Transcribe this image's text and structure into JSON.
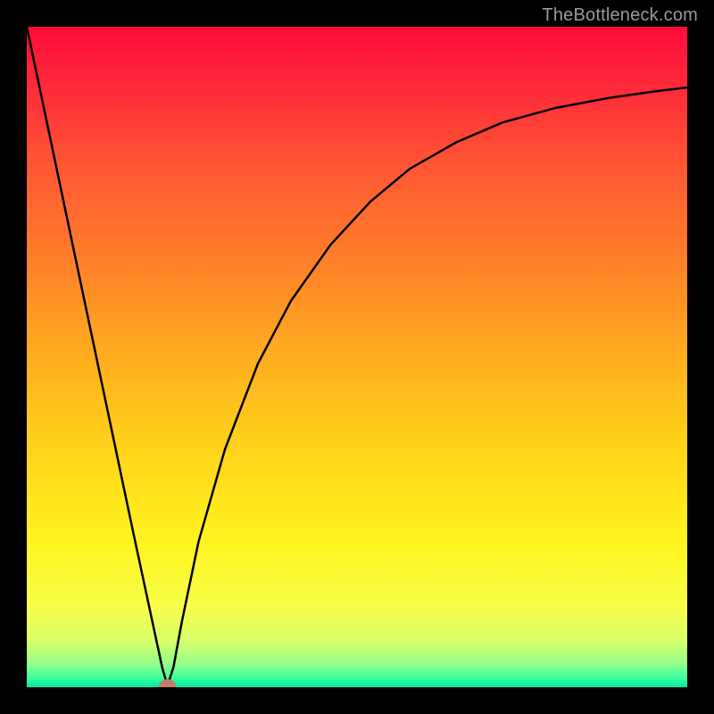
{
  "watermark": "TheBottleneck.com",
  "chart_data": {
    "type": "line",
    "title": "",
    "xlabel": "",
    "ylabel": "",
    "xlim": [
      0,
      1
    ],
    "ylim": [
      0,
      1
    ],
    "background_gradient": {
      "stops": [
        {
          "pos": 0.0,
          "color": "#ff0a3a"
        },
        {
          "pos": 0.1,
          "color": "#ff2d3a"
        },
        {
          "pos": 0.22,
          "color": "#ff5a33"
        },
        {
          "pos": 0.35,
          "color": "#ff7e2a"
        },
        {
          "pos": 0.5,
          "color": "#ffae1f"
        },
        {
          "pos": 0.65,
          "color": "#ffd61a"
        },
        {
          "pos": 0.78,
          "color": "#fff41f"
        },
        {
          "pos": 0.88,
          "color": "#f6ff4a"
        },
        {
          "pos": 0.93,
          "color": "#d8ff6a"
        },
        {
          "pos": 0.965,
          "color": "#93ff8a"
        },
        {
          "pos": 0.985,
          "color": "#3fff9e"
        },
        {
          "pos": 1.0,
          "color": "#00e9a2"
        }
      ]
    },
    "series": [
      {
        "name": "bottleneck-curve",
        "color": "#000000",
        "stroke_width": 2.5,
        "points": [
          {
            "x": 0.0,
            "y": 1.0
          },
          {
            "x": 0.04,
            "y": 0.81
          },
          {
            "x": 0.08,
            "y": 0.62
          },
          {
            "x": 0.12,
            "y": 0.43
          },
          {
            "x": 0.16,
            "y": 0.24
          },
          {
            "x": 0.19,
            "y": 0.1
          },
          {
            "x": 0.205,
            "y": 0.03
          },
          {
            "x": 0.213,
            "y": 0.002
          },
          {
            "x": 0.222,
            "y": 0.03
          },
          {
            "x": 0.235,
            "y": 0.1
          },
          {
            "x": 0.26,
            "y": 0.22
          },
          {
            "x": 0.3,
            "y": 0.36
          },
          {
            "x": 0.35,
            "y": 0.49
          },
          {
            "x": 0.4,
            "y": 0.585
          },
          {
            "x": 0.46,
            "y": 0.67
          },
          {
            "x": 0.52,
            "y": 0.735
          },
          {
            "x": 0.58,
            "y": 0.785
          },
          {
            "x": 0.65,
            "y": 0.825
          },
          {
            "x": 0.72,
            "y": 0.855
          },
          {
            "x": 0.8,
            "y": 0.877
          },
          {
            "x": 0.88,
            "y": 0.892
          },
          {
            "x": 0.95,
            "y": 0.902
          },
          {
            "x": 1.0,
            "y": 0.908
          }
        ]
      }
    ],
    "marker": {
      "name": "optimal-point",
      "x": 0.213,
      "y": 0.002,
      "rx": 0.013,
      "ry": 0.01,
      "color": "#c77b6f"
    }
  }
}
